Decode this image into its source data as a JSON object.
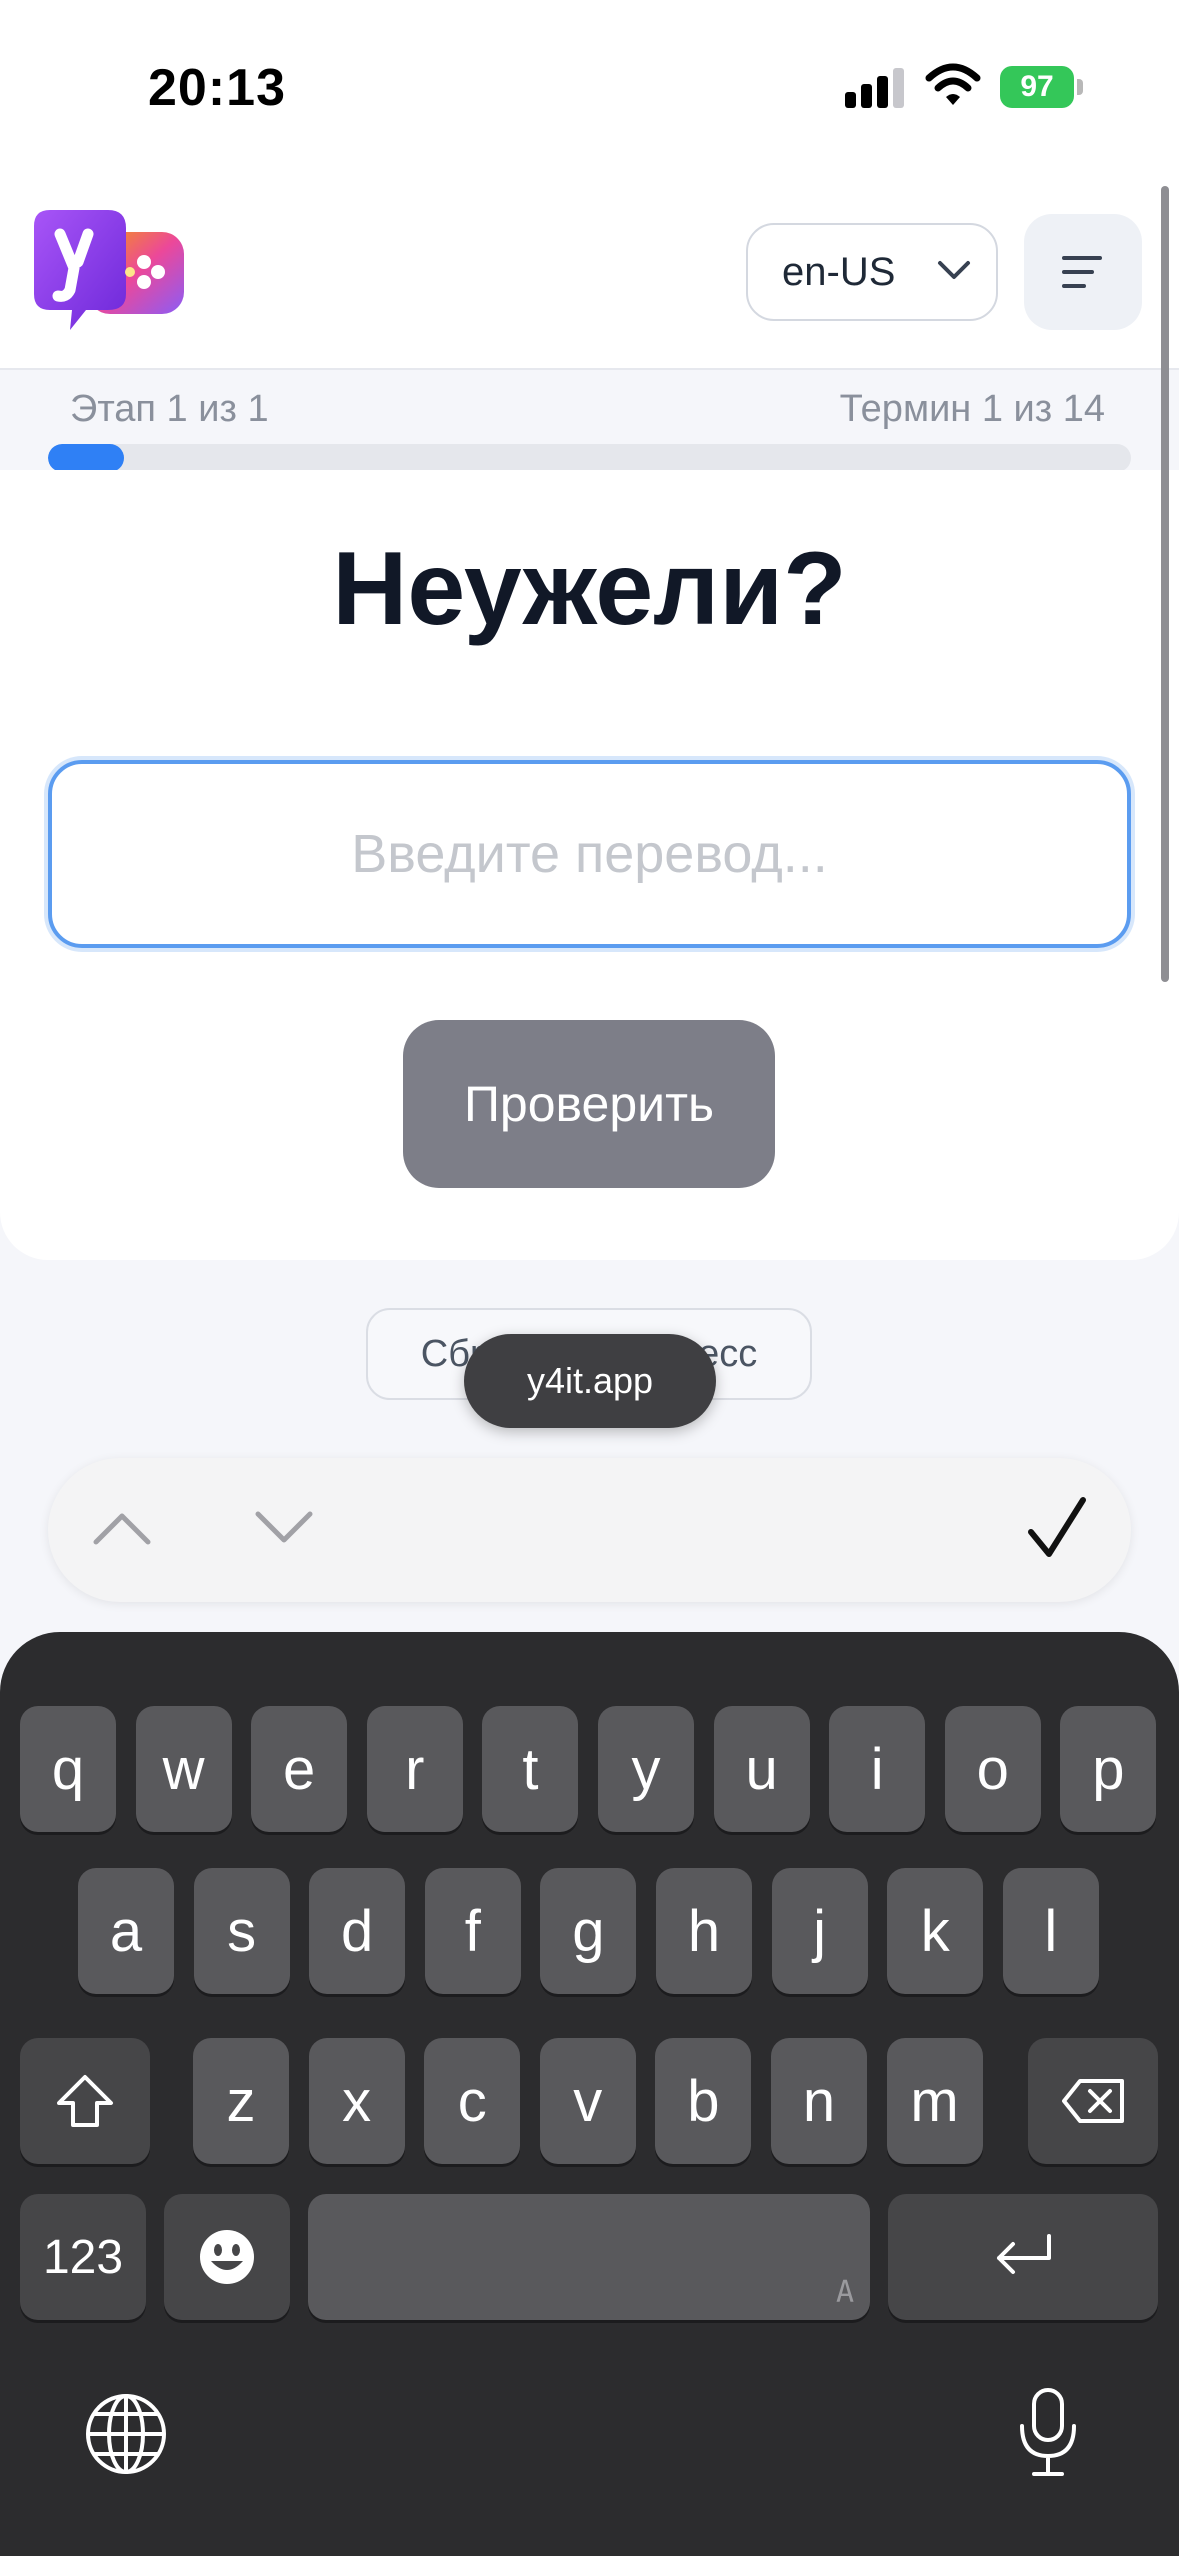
{
  "status_bar": {
    "time": "20:13",
    "battery": "97",
    "icons": [
      "signal-icon",
      "wifi-icon",
      "battery-charging-icon"
    ]
  },
  "header": {
    "logo": "y4it-logo",
    "language": "en-US",
    "menu_icon": "menu-icon"
  },
  "progress": {
    "stage_label": "Этап 1 из 1",
    "term_label": "Термин 1 из 14",
    "fraction": 0.07,
    "accent": "#2f80f5"
  },
  "card": {
    "term": "Неужели?",
    "input_placeholder": "Введите перевод...",
    "input_value": "",
    "check_label": "Проверить"
  },
  "reset_label": "Сбросить прогресс",
  "toast": "y4it.app",
  "accessory": {
    "icons": [
      "chevron-up-icon",
      "chevron-down-icon",
      "checkmark-icon"
    ]
  },
  "keyboard": {
    "row1": [
      "q",
      "w",
      "e",
      "r",
      "t",
      "y",
      "u",
      "i",
      "o",
      "p"
    ],
    "row2": [
      "a",
      "s",
      "d",
      "f",
      "g",
      "h",
      "j",
      "k",
      "l"
    ],
    "row3": [
      "z",
      "x",
      "c",
      "v",
      "b",
      "n",
      "m"
    ],
    "numbers_key": "123",
    "space_hint": "A",
    "icons": [
      "shift-icon",
      "backspace-icon",
      "emoji-icon",
      "return-icon",
      "globe-icon",
      "microphone-icon"
    ]
  }
}
